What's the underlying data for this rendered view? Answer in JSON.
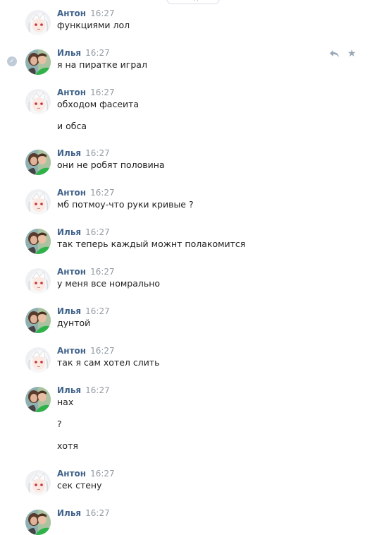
{
  "date_divider": "д",
  "messages": [
    {
      "author": "Антон",
      "time": "16:27",
      "avatar": "anime-avatar",
      "lines": [
        "функциями лол"
      ]
    },
    {
      "author": "Илья",
      "time": "16:27",
      "avatar": "photo-avatar",
      "lines": [
        "я на пиратке играл"
      ]
    },
    {
      "author": "Антон",
      "time": "16:27",
      "avatar": "anime-avatar",
      "lines": [
        "обходом фасеита",
        "и обса"
      ]
    },
    {
      "author": "Илья",
      "time": "16:27",
      "avatar": "photo-avatar",
      "lines": [
        "они не робят половина"
      ]
    },
    {
      "author": "Антон",
      "time": "16:27",
      "avatar": "anime-avatar",
      "lines": [
        "мб потмоу-что руки кривые ?"
      ]
    },
    {
      "author": "Илья",
      "time": "16:27",
      "avatar": "photo-avatar",
      "lines": [
        "так теперь каждый можнт полакомится"
      ]
    },
    {
      "author": "Антон",
      "time": "16:27",
      "avatar": "anime-avatar",
      "lines": [
        "у меня все номрально"
      ]
    },
    {
      "author": "Илья",
      "time": "16:27",
      "avatar": "photo-avatar",
      "lines": [
        "дунтой"
      ]
    },
    {
      "author": "Антон",
      "time": "16:27",
      "avatar": "anime-avatar",
      "lines": [
        "так я сам хотел слить"
      ]
    },
    {
      "author": "Илья",
      "time": "16:27",
      "avatar": "photo-avatar",
      "lines": [
        "нах",
        "?",
        "хотя"
      ]
    },
    {
      "author": "Антон",
      "time": "16:27",
      "avatar": "anime-avatar",
      "lines": [
        "сек стену"
      ]
    },
    {
      "author": "Илья",
      "time": "16:27",
      "avatar": "photo-avatar",
      "lines": []
    }
  ],
  "actions": {
    "selected_icon": "check-circle-icon",
    "reply_icon": "reply-icon",
    "favorite_icon": "star-icon"
  }
}
